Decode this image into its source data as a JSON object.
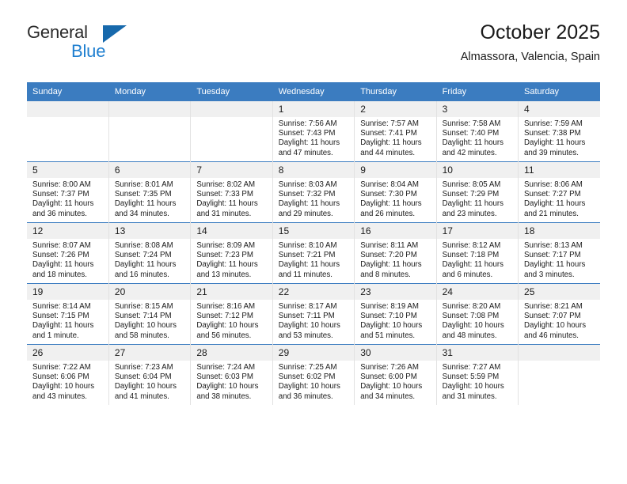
{
  "logo": {
    "word1": "General",
    "word2": "Blue",
    "triangle_color": "#1769ac",
    "blue_color": "#1f7fd0"
  },
  "header": {
    "title": "October 2025",
    "subtitle": "Almassora, Valencia, Spain"
  },
  "theme": {
    "header_bg": "#3b7cc0",
    "daynum_bg": "#f0f0f0",
    "cell_bg": "#ffffff",
    "row_divider": "#3b7cc0"
  },
  "weekdays": [
    "Sunday",
    "Monday",
    "Tuesday",
    "Wednesday",
    "Thursday",
    "Friday",
    "Saturday"
  ],
  "labels": {
    "sunrise_prefix": "Sunrise:",
    "sunset_prefix": "Sunset:",
    "daylight_prefix": "Daylight:"
  },
  "weeks": [
    [
      {
        "empty": true
      },
      {
        "empty": true
      },
      {
        "empty": true
      },
      {
        "day": "1",
        "sunrise": "Sunrise: 7:56 AM",
        "sunset": "Sunset: 7:43 PM",
        "daylight_line1": "Daylight: 11 hours",
        "daylight_line2": "and 47 minutes."
      },
      {
        "day": "2",
        "sunrise": "Sunrise: 7:57 AM",
        "sunset": "Sunset: 7:41 PM",
        "daylight_line1": "Daylight: 11 hours",
        "daylight_line2": "and 44 minutes."
      },
      {
        "day": "3",
        "sunrise": "Sunrise: 7:58 AM",
        "sunset": "Sunset: 7:40 PM",
        "daylight_line1": "Daylight: 11 hours",
        "daylight_line2": "and 42 minutes."
      },
      {
        "day": "4",
        "sunrise": "Sunrise: 7:59 AM",
        "sunset": "Sunset: 7:38 PM",
        "daylight_line1": "Daylight: 11 hours",
        "daylight_line2": "and 39 minutes."
      }
    ],
    [
      {
        "day": "5",
        "sunrise": "Sunrise: 8:00 AM",
        "sunset": "Sunset: 7:37 PM",
        "daylight_line1": "Daylight: 11 hours",
        "daylight_line2": "and 36 minutes."
      },
      {
        "day": "6",
        "sunrise": "Sunrise: 8:01 AM",
        "sunset": "Sunset: 7:35 PM",
        "daylight_line1": "Daylight: 11 hours",
        "daylight_line2": "and 34 minutes."
      },
      {
        "day": "7",
        "sunrise": "Sunrise: 8:02 AM",
        "sunset": "Sunset: 7:33 PM",
        "daylight_line1": "Daylight: 11 hours",
        "daylight_line2": "and 31 minutes."
      },
      {
        "day": "8",
        "sunrise": "Sunrise: 8:03 AM",
        "sunset": "Sunset: 7:32 PM",
        "daylight_line1": "Daylight: 11 hours",
        "daylight_line2": "and 29 minutes."
      },
      {
        "day": "9",
        "sunrise": "Sunrise: 8:04 AM",
        "sunset": "Sunset: 7:30 PM",
        "daylight_line1": "Daylight: 11 hours",
        "daylight_line2": "and 26 minutes."
      },
      {
        "day": "10",
        "sunrise": "Sunrise: 8:05 AM",
        "sunset": "Sunset: 7:29 PM",
        "daylight_line1": "Daylight: 11 hours",
        "daylight_line2": "and 23 minutes."
      },
      {
        "day": "11",
        "sunrise": "Sunrise: 8:06 AM",
        "sunset": "Sunset: 7:27 PM",
        "daylight_line1": "Daylight: 11 hours",
        "daylight_line2": "and 21 minutes."
      }
    ],
    [
      {
        "day": "12",
        "sunrise": "Sunrise: 8:07 AM",
        "sunset": "Sunset: 7:26 PM",
        "daylight_line1": "Daylight: 11 hours",
        "daylight_line2": "and 18 minutes."
      },
      {
        "day": "13",
        "sunrise": "Sunrise: 8:08 AM",
        "sunset": "Sunset: 7:24 PM",
        "daylight_line1": "Daylight: 11 hours",
        "daylight_line2": "and 16 minutes."
      },
      {
        "day": "14",
        "sunrise": "Sunrise: 8:09 AM",
        "sunset": "Sunset: 7:23 PM",
        "daylight_line1": "Daylight: 11 hours",
        "daylight_line2": "and 13 minutes."
      },
      {
        "day": "15",
        "sunrise": "Sunrise: 8:10 AM",
        "sunset": "Sunset: 7:21 PM",
        "daylight_line1": "Daylight: 11 hours",
        "daylight_line2": "and 11 minutes."
      },
      {
        "day": "16",
        "sunrise": "Sunrise: 8:11 AM",
        "sunset": "Sunset: 7:20 PM",
        "daylight_line1": "Daylight: 11 hours",
        "daylight_line2": "and 8 minutes."
      },
      {
        "day": "17",
        "sunrise": "Sunrise: 8:12 AM",
        "sunset": "Sunset: 7:18 PM",
        "daylight_line1": "Daylight: 11 hours",
        "daylight_line2": "and 6 minutes."
      },
      {
        "day": "18",
        "sunrise": "Sunrise: 8:13 AM",
        "sunset": "Sunset: 7:17 PM",
        "daylight_line1": "Daylight: 11 hours",
        "daylight_line2": "and 3 minutes."
      }
    ],
    [
      {
        "day": "19",
        "sunrise": "Sunrise: 8:14 AM",
        "sunset": "Sunset: 7:15 PM",
        "daylight_line1": "Daylight: 11 hours",
        "daylight_line2": "and 1 minute."
      },
      {
        "day": "20",
        "sunrise": "Sunrise: 8:15 AM",
        "sunset": "Sunset: 7:14 PM",
        "daylight_line1": "Daylight: 10 hours",
        "daylight_line2": "and 58 minutes."
      },
      {
        "day": "21",
        "sunrise": "Sunrise: 8:16 AM",
        "sunset": "Sunset: 7:12 PM",
        "daylight_line1": "Daylight: 10 hours",
        "daylight_line2": "and 56 minutes."
      },
      {
        "day": "22",
        "sunrise": "Sunrise: 8:17 AM",
        "sunset": "Sunset: 7:11 PM",
        "daylight_line1": "Daylight: 10 hours",
        "daylight_line2": "and 53 minutes."
      },
      {
        "day": "23",
        "sunrise": "Sunrise: 8:19 AM",
        "sunset": "Sunset: 7:10 PM",
        "daylight_line1": "Daylight: 10 hours",
        "daylight_line2": "and 51 minutes."
      },
      {
        "day": "24",
        "sunrise": "Sunrise: 8:20 AM",
        "sunset": "Sunset: 7:08 PM",
        "daylight_line1": "Daylight: 10 hours",
        "daylight_line2": "and 48 minutes."
      },
      {
        "day": "25",
        "sunrise": "Sunrise: 8:21 AM",
        "sunset": "Sunset: 7:07 PM",
        "daylight_line1": "Daylight: 10 hours",
        "daylight_line2": "and 46 minutes."
      }
    ],
    [
      {
        "day": "26",
        "sunrise": "Sunrise: 7:22 AM",
        "sunset": "Sunset: 6:06 PM",
        "daylight_line1": "Daylight: 10 hours",
        "daylight_line2": "and 43 minutes."
      },
      {
        "day": "27",
        "sunrise": "Sunrise: 7:23 AM",
        "sunset": "Sunset: 6:04 PM",
        "daylight_line1": "Daylight: 10 hours",
        "daylight_line2": "and 41 minutes."
      },
      {
        "day": "28",
        "sunrise": "Sunrise: 7:24 AM",
        "sunset": "Sunset: 6:03 PM",
        "daylight_line1": "Daylight: 10 hours",
        "daylight_line2": "and 38 minutes."
      },
      {
        "day": "29",
        "sunrise": "Sunrise: 7:25 AM",
        "sunset": "Sunset: 6:02 PM",
        "daylight_line1": "Daylight: 10 hours",
        "daylight_line2": "and 36 minutes."
      },
      {
        "day": "30",
        "sunrise": "Sunrise: 7:26 AM",
        "sunset": "Sunset: 6:00 PM",
        "daylight_line1": "Daylight: 10 hours",
        "daylight_line2": "and 34 minutes."
      },
      {
        "day": "31",
        "sunrise": "Sunrise: 7:27 AM",
        "sunset": "Sunset: 5:59 PM",
        "daylight_line1": "Daylight: 10 hours",
        "daylight_line2": "and 31 minutes."
      },
      {
        "empty": true
      }
    ]
  ]
}
